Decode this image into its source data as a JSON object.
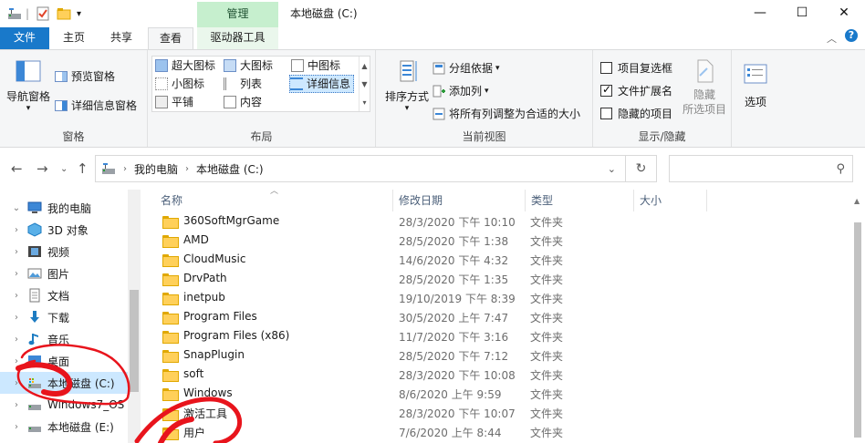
{
  "window": {
    "title": "本地磁盘 (C:)",
    "context_tab_group": "管理",
    "controls": [
      "minimize-icon",
      "maximize-icon",
      "close-icon"
    ]
  },
  "ribbon_tabs": [
    {
      "label": "文件"
    },
    {
      "label": "主页"
    },
    {
      "label": "共享"
    },
    {
      "label": "查看"
    },
    {
      "label": "驱动器工具"
    }
  ],
  "ribbon": {
    "pane_group": {
      "label": "窗格",
      "nav_pane": "导航窗格",
      "preview_pane": "预览窗格",
      "details_pane": "详细信息窗格"
    },
    "layout_group": {
      "label": "布局",
      "items": [
        "超大图标",
        "大图标",
        "中图标",
        "小图标",
        "列表",
        "详细信息",
        "平铺",
        "内容"
      ]
    },
    "current_view_group": {
      "label": "当前视图",
      "sort_by": "排序方式",
      "group_by": "分组依据",
      "add_columns": "添加列",
      "fit_columns": "将所有列调整为合适的大小"
    },
    "show_hide_group": {
      "label": "显示/隐藏",
      "item_checkboxes": {
        "label": "项目复选框",
        "checked": false
      },
      "file_extensions": {
        "label": "文件扩展名",
        "checked": true
      },
      "hidden_items": {
        "label": "隐藏的项目",
        "checked": false
      },
      "hide_selected": "隐藏\n所选项目"
    },
    "options": "选项"
  },
  "address": {
    "crumbs": [
      "我的电脑",
      "本地磁盘 (C:)"
    ]
  },
  "nav_pane": {
    "items": [
      {
        "label": "我的电脑",
        "icon": "computer-icon",
        "selected": false
      },
      {
        "label": "3D 对象",
        "icon": "3d-objects-icon",
        "selected": false
      },
      {
        "label": "视频",
        "icon": "video-icon",
        "selected": false
      },
      {
        "label": "图片",
        "icon": "pictures-icon",
        "selected": false
      },
      {
        "label": "文档",
        "icon": "documents-icon",
        "selected": false
      },
      {
        "label": "下载",
        "icon": "download-icon",
        "selected": false
      },
      {
        "label": "音乐",
        "icon": "music-icon",
        "selected": false
      },
      {
        "label": "桌面",
        "icon": "desktop-icon",
        "selected": false
      },
      {
        "label": "本地磁盘 (C:)",
        "icon": "drive-icon",
        "selected": true
      },
      {
        "label": "Windows7_OS",
        "icon": "drive-icon",
        "selected": false
      },
      {
        "label": "本地磁盘 (E:)",
        "icon": "drive-icon",
        "selected": false
      }
    ]
  },
  "file_list": {
    "columns": [
      "名称",
      "修改日期",
      "类型",
      "大小"
    ],
    "rows": [
      {
        "name": "360SoftMgrGame",
        "date": "28/3/2020 下午 10:10",
        "type": "文件夹"
      },
      {
        "name": "AMD",
        "date": "28/5/2020 下午 1:38",
        "type": "文件夹"
      },
      {
        "name": "CloudMusic",
        "date": "14/6/2020 下午 4:32",
        "type": "文件夹"
      },
      {
        "name": "DrvPath",
        "date": "28/5/2020 下午 1:35",
        "type": "文件夹"
      },
      {
        "name": "inetpub",
        "date": "19/10/2019 下午 8:39",
        "type": "文件夹"
      },
      {
        "name": "Program Files",
        "date": "30/5/2020 上午 7:47",
        "type": "文件夹"
      },
      {
        "name": "Program Files (x86)",
        "date": "11/7/2020 下午 3:16",
        "type": "文件夹"
      },
      {
        "name": "SnapPlugin",
        "date": "28/5/2020 下午 7:12",
        "type": "文件夹"
      },
      {
        "name": "soft",
        "date": "28/3/2020 下午 10:08",
        "type": "文件夹"
      },
      {
        "name": "Windows",
        "date": "8/6/2020 上午 9:59",
        "type": "文件夹"
      },
      {
        "name": "激活工具",
        "date": "28/3/2020 下午 10:07",
        "type": "文件夹"
      },
      {
        "name": "用户",
        "date": "7/6/2020 上午 8:44",
        "type": "文件夹"
      }
    ]
  },
  "colors": {
    "file_tab": "#1979ca",
    "context_tab": "#c6efce",
    "selection": "#cce8ff",
    "annotation": "#e8141c"
  }
}
